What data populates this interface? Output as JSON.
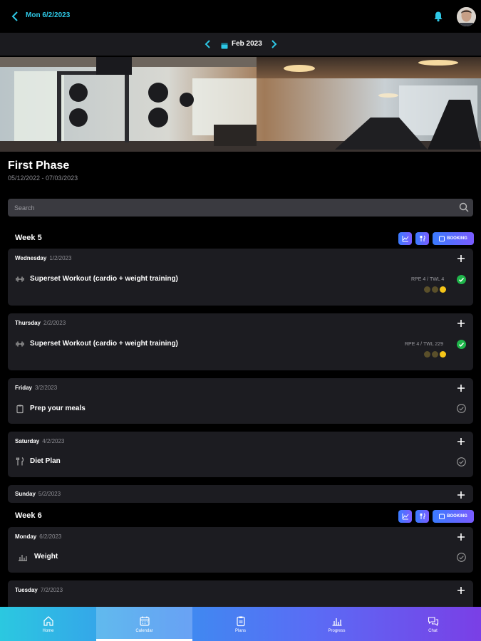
{
  "header": {
    "title": "Mon 6/2/2023"
  },
  "month": {
    "label": "Feb 2023"
  },
  "phase": {
    "title": "First Phase",
    "dates": "05/12/2022 - 07/03/2023"
  },
  "search": {
    "placeholder": "Search"
  },
  "weeks": [
    {
      "label": "Week 5",
      "booking_label": "BOOKING"
    },
    {
      "label": "Week 6",
      "booking_label": "BOOKING"
    }
  ],
  "days": [
    {
      "name": "Wednesday",
      "date": "1/2/2023",
      "item": "Superset Workout (cardio + weight training)",
      "rpe": "RPE 4 / TWL 4",
      "status": "done"
    },
    {
      "name": "Thursday",
      "date": "2/2/2023",
      "item": "Superset Workout (cardio + weight training)",
      "rpe": "RPE 4 / TWL 229",
      "status": "done"
    },
    {
      "name": "Friday",
      "date": "3/2/2023",
      "item": "Prep your meals",
      "status": "todo"
    },
    {
      "name": "Saturday",
      "date": "4/2/2023",
      "item": "Diet Plan",
      "status": "todo"
    },
    {
      "name": "Sunday",
      "date": "5/2/2023"
    },
    {
      "name": "Monday",
      "date": "6/2/2023",
      "item": "Weight",
      "status": "todo"
    },
    {
      "name": "Tuesday",
      "date": "7/2/2023"
    }
  ],
  "nav": [
    {
      "label": "Home",
      "icon": "home-icon"
    },
    {
      "label": "Calendar",
      "icon": "calendar-icon",
      "active": true
    },
    {
      "label": "Plans",
      "icon": "clipboard-icon"
    },
    {
      "label": "Progress",
      "icon": "bar-chart-icon"
    },
    {
      "label": "Chat",
      "icon": "chat-icon"
    }
  ],
  "colors": {
    "accent": "#2ec8e6",
    "success": "#1fb54a",
    "card": "#1c1c21",
    "booking_gradient_start": "#3a7bff",
    "booking_gradient_end": "#7a5cff"
  }
}
